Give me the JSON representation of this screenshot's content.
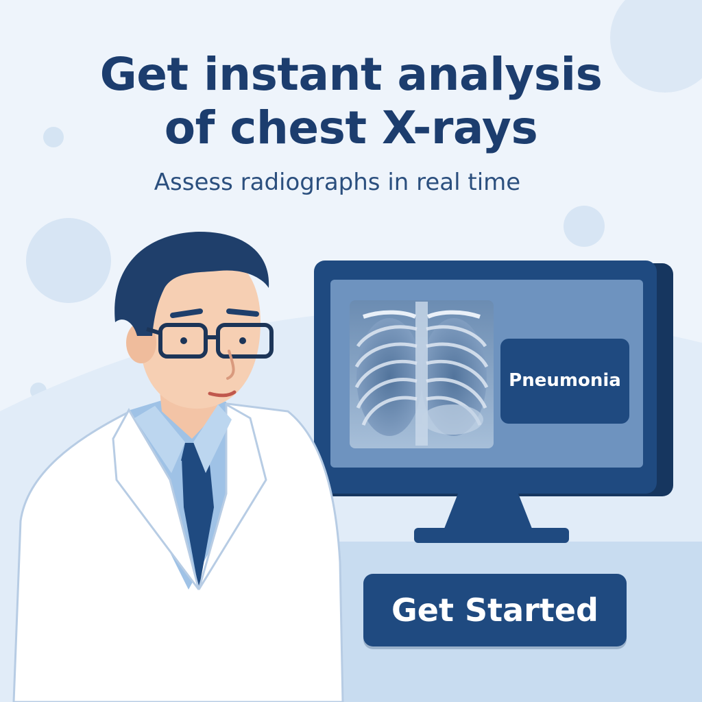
{
  "headline": {
    "line1": "Get instant analysis",
    "line2": "of chest X-rays"
  },
  "subtitle": "Assess radiographs in real time",
  "monitor": {
    "result_label": "Pneumonia"
  },
  "cta": {
    "label": "Get Started"
  },
  "colors": {
    "primary": "#1f4a80",
    "headline": "#1c3d6e",
    "background": "#eef4fb",
    "accent_light": "#c9dcf1"
  },
  "icons": {
    "doctor": "doctor-illustration",
    "xray": "chest-xray-image",
    "monitor": "monitor-icon"
  }
}
